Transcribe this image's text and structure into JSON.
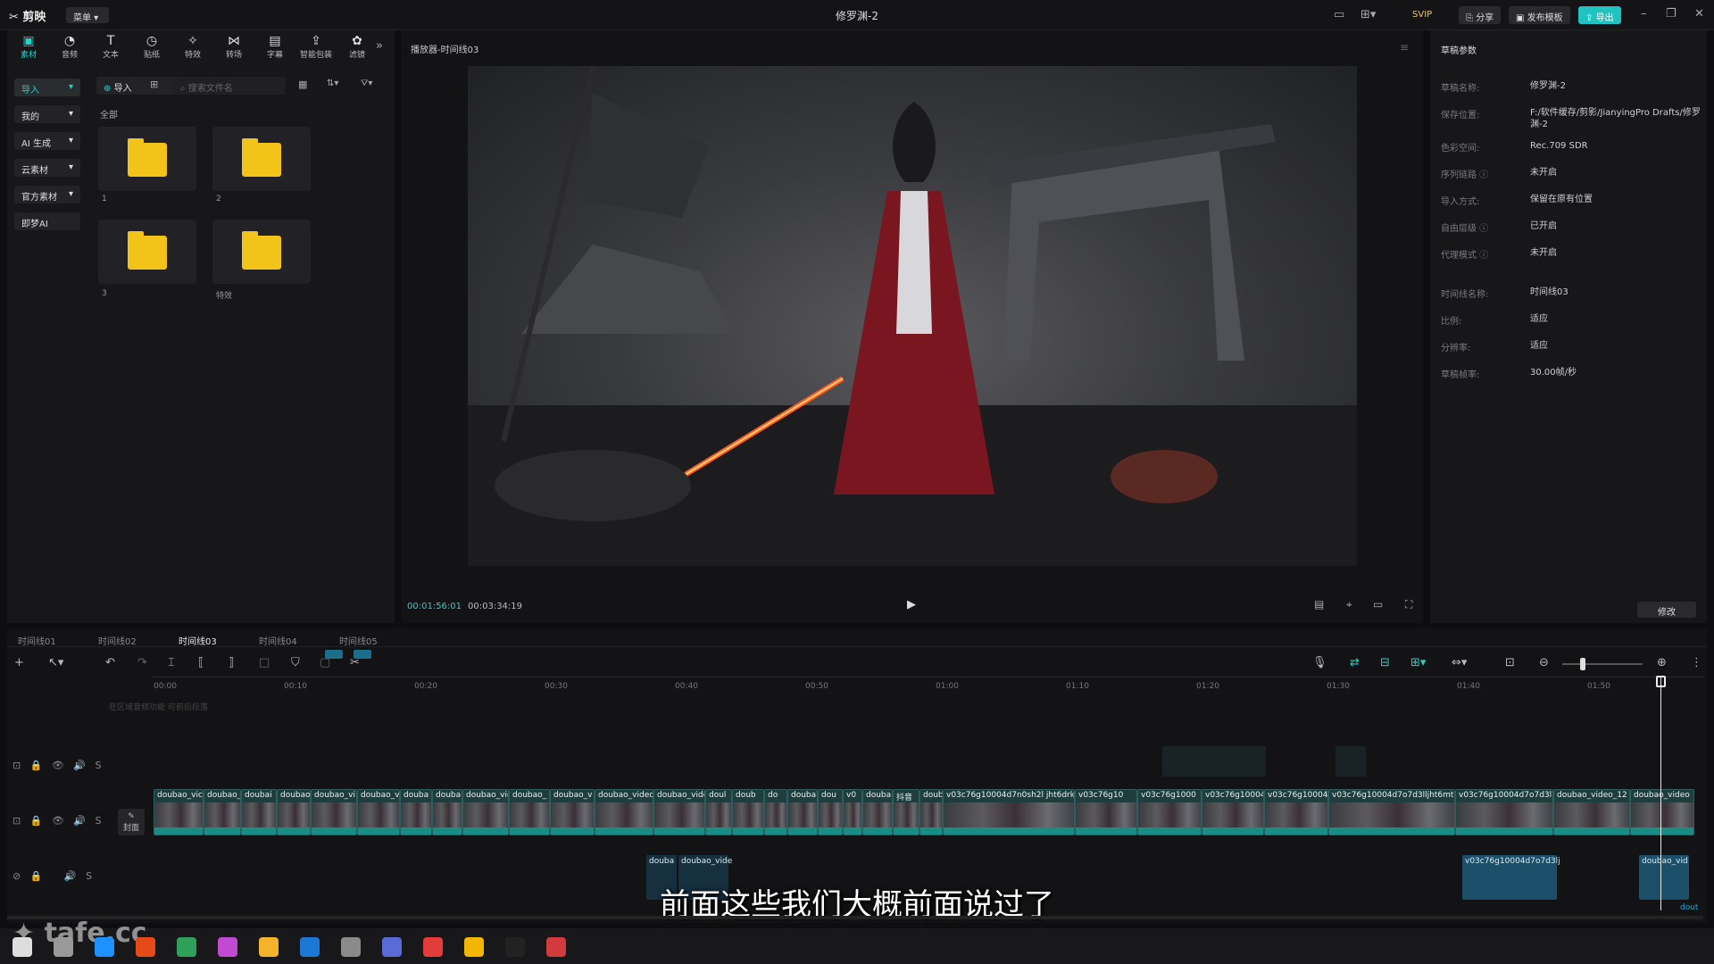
{
  "app": {
    "name": "剪映",
    "menu_label": "菜单",
    "title": "修罗渊-2"
  },
  "topbar": {
    "svip": "SVIP",
    "share": "分享",
    "publish_template": "发布模板",
    "export": "导出"
  },
  "toolbar": [
    {
      "label": "素材",
      "icon": "media-icon"
    },
    {
      "label": "音频",
      "icon": "audio-icon"
    },
    {
      "label": "文本",
      "icon": "text-icon"
    },
    {
      "label": "贴纸",
      "icon": "sticker-icon"
    },
    {
      "label": "特效",
      "icon": "effects-icon"
    },
    {
      "label": "转场",
      "icon": "transition-icon"
    },
    {
      "label": "字幕",
      "icon": "subtitle-icon"
    },
    {
      "label": "智能包装",
      "icon": "package-icon"
    },
    {
      "label": "滤镜",
      "icon": "filter-icon"
    }
  ],
  "sidebar": [
    "导入",
    "我的",
    "AI 生成",
    "云素材",
    "官方素材",
    "即梦AI"
  ],
  "media": {
    "import_label": "导入",
    "search_placeholder": "搜索文件名",
    "section": "全部",
    "folders": [
      "1",
      "2",
      "3",
      "特效"
    ]
  },
  "player": {
    "title": "播放器-时间线03",
    "current_time": "00:01:56:01",
    "total_time": "00:03:34:19"
  },
  "props": {
    "title": "草稿参数",
    "rows": [
      {
        "k": "草稿名称:",
        "v": "修罗渊-2"
      },
      {
        "k": "保存位置:",
        "v": "F:/软件缓存/剪影/JianyingPro Drafts/修罗渊-2"
      },
      {
        "k": "色彩空间:",
        "v": "Rec.709 SDR"
      },
      {
        "k": "序列链路 ⓘ",
        "v": "未开启"
      },
      {
        "k": "导入方式:",
        "v": "保留在原有位置"
      },
      {
        "k": "自由层级 ⓘ",
        "v": "已开启"
      },
      {
        "k": "代理模式 ⓘ",
        "v": "未开启"
      },
      {
        "k": "时间线名称:",
        "v": "时间线03"
      },
      {
        "k": "比例:",
        "v": "适应"
      },
      {
        "k": "分辨率:",
        "v": "适应"
      },
      {
        "k": "草稿帧率:",
        "v": "30.00帧/秒"
      }
    ],
    "edit": "修改"
  },
  "timeline": {
    "tabs": [
      "时间线01",
      "时间线02",
      "时间线03",
      "时间线04",
      "时间线05"
    ],
    "ruler": [
      "00:00",
      "00:10",
      "00:20",
      "00:30",
      "00:40",
      "00:50",
      "01:00",
      "01:10",
      "01:20",
      "01:30",
      "01:40",
      "01:50"
    ],
    "hint": "在区域音频功能    可前后段落",
    "cover_label": "封面",
    "clips": [
      "doubao_vic",
      "doubao_",
      "doubai",
      "doubao",
      "doubao_vi",
      "doubao_v",
      "douba",
      "douba",
      "doubao_vid",
      "doubao_",
      "doubao_v",
      "doubao_video",
      "doubao_vide",
      "doul",
      "doub",
      "do",
      "douba",
      "dou",
      "v0",
      "douba",
      "抖音",
      "doub",
      "v03c76g10004d7n0sh2l jht6drk",
      "v03c76g10",
      "v03c76g1000",
      "v03c76g10004",
      "v03c76g10004",
      "v03c76g10004d7o7d3lljht6mt",
      "v03c76g10004d7o7d3l",
      "doubao_video_12",
      "doubao_video"
    ],
    "audio_clips": [
      "douba",
      "doubao_vide",
      "v03c76g10004d7o7d3lj",
      "doubao_vid"
    ]
  },
  "subtitle": "前面这些我们大概前面说过了",
  "watermark": "tafe.cc",
  "colors": {
    "accent": "#21d3c9",
    "clip": "#1f3d3d",
    "audio": "#1b4f6a"
  }
}
